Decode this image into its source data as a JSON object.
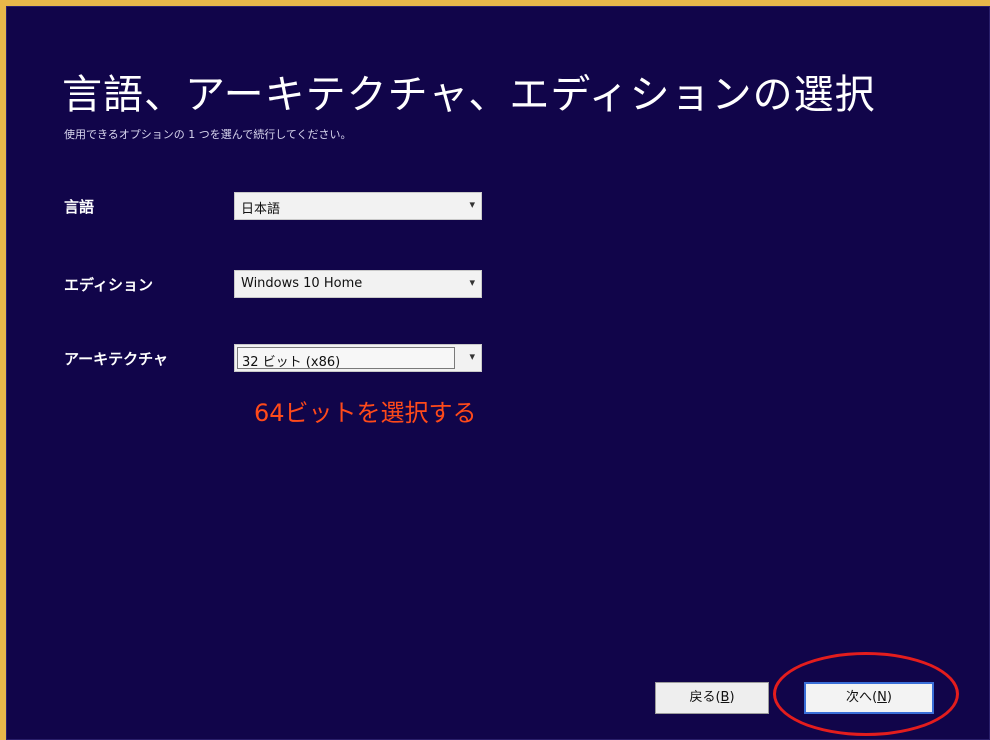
{
  "title": "言語、アーキテクチャ、エディションの選択",
  "subtitle": "使用できるオプションの 1 つを選んで続行してください。",
  "fields": [
    {
      "label": "言語",
      "value": "日本語"
    },
    {
      "label": "エディション",
      "value": "Windows 10 Home"
    },
    {
      "label": "アーキテクチャ",
      "value": "32 ビット (x86)"
    }
  ],
  "annotation": "64ビットを選択する",
  "buttons": {
    "back": {
      "label": "戻る",
      "accel": "B"
    },
    "next": {
      "label": "次へ",
      "accel": "N"
    }
  },
  "colors": {
    "background": "#11054a",
    "annotation": "#ff4a1a",
    "highlight_circle": "#e31d1d",
    "frame": "#e8b84a"
  }
}
